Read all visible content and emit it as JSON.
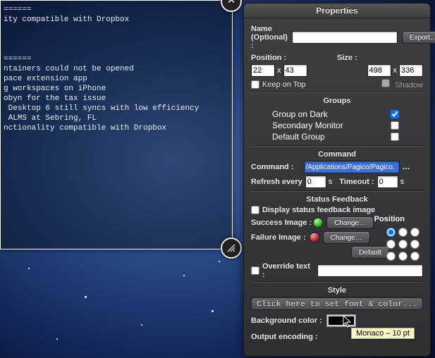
{
  "geeklet": {
    "lines": [
      "======",
      "ity compatible with Dropbox",
      "",
      "",
      "",
      "======",
      "ntainers could not be opened",
      "pace extension app",
      "g workspaces on iPhone",
      "obyn for the tax issue",
      " Desktop 6 still syncs with low efficiency",
      " ALMS at Sebring, FL",
      "nctionality compatible with Dropbox"
    ]
  },
  "panel": {
    "title": "Properties",
    "name_label": "Name (Optional) :",
    "name_value": "",
    "export": "Export…",
    "position_label": "Position :",
    "pos_x": "22",
    "pos_y": "43",
    "x_sep": "x",
    "size_label": "Size :",
    "size_w": "498",
    "size_h": "336",
    "keep_on_top": "Keep on Top",
    "shadow": "Shadow",
    "groups_title": "Groups",
    "groups": [
      {
        "label": "Group on Dark",
        "checked": true
      },
      {
        "label": "Secondary Monitor",
        "checked": false
      },
      {
        "label": "Default Group",
        "checked": false
      }
    ],
    "command_title": "Command",
    "command_label": "Command :",
    "command_value": "/Applications/Pagico/Pagico.",
    "refresh_label": "Refresh every",
    "refresh_val": "0",
    "sec_unit": "s",
    "timeout_label": "Timeout :",
    "timeout_val": "0",
    "status_title": "Status Feedback",
    "display_status": "Display status feedback image",
    "position_word": "Position",
    "success_label": "Success Image :",
    "failure_label": "Failure Image :",
    "change": "Change…",
    "default": "Default",
    "override_label": "Override text :",
    "override_value": "",
    "style_title": "Style",
    "font_button": "Click here to set font & color...",
    "bg_label": "Background color :",
    "tooltip": "Monaco – 10 pt",
    "output_label": "Output encoding :"
  }
}
